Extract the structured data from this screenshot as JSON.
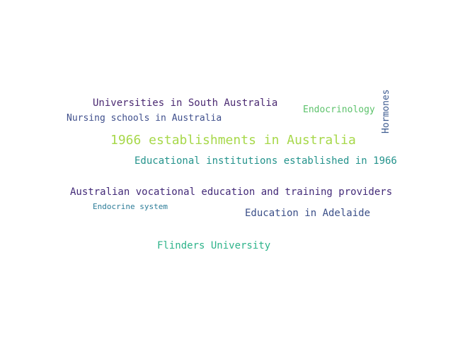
{
  "words": [
    {
      "text": "Universities in South Australia",
      "color": "#4b2a72"
    },
    {
      "text": "Nursing schools in Australia",
      "color": "#3f4f8c"
    },
    {
      "text": "Endocrinology",
      "color": "#5cc26b"
    },
    {
      "text": "Hormones",
      "color": "#3c5a8f"
    },
    {
      "text": "1966 establishments in Australia",
      "color": "#a7d84a"
    },
    {
      "text": "Educational institutions established in 1966",
      "color": "#24938c"
    },
    {
      "text": "Australian vocational education and training providers",
      "color": "#432a78"
    },
    {
      "text": "Endocrine system",
      "color": "#2c7c98"
    },
    {
      "text": "Education in Adelaide",
      "color": "#3b4f88"
    },
    {
      "text": "Flinders University",
      "color": "#2db38a"
    }
  ]
}
